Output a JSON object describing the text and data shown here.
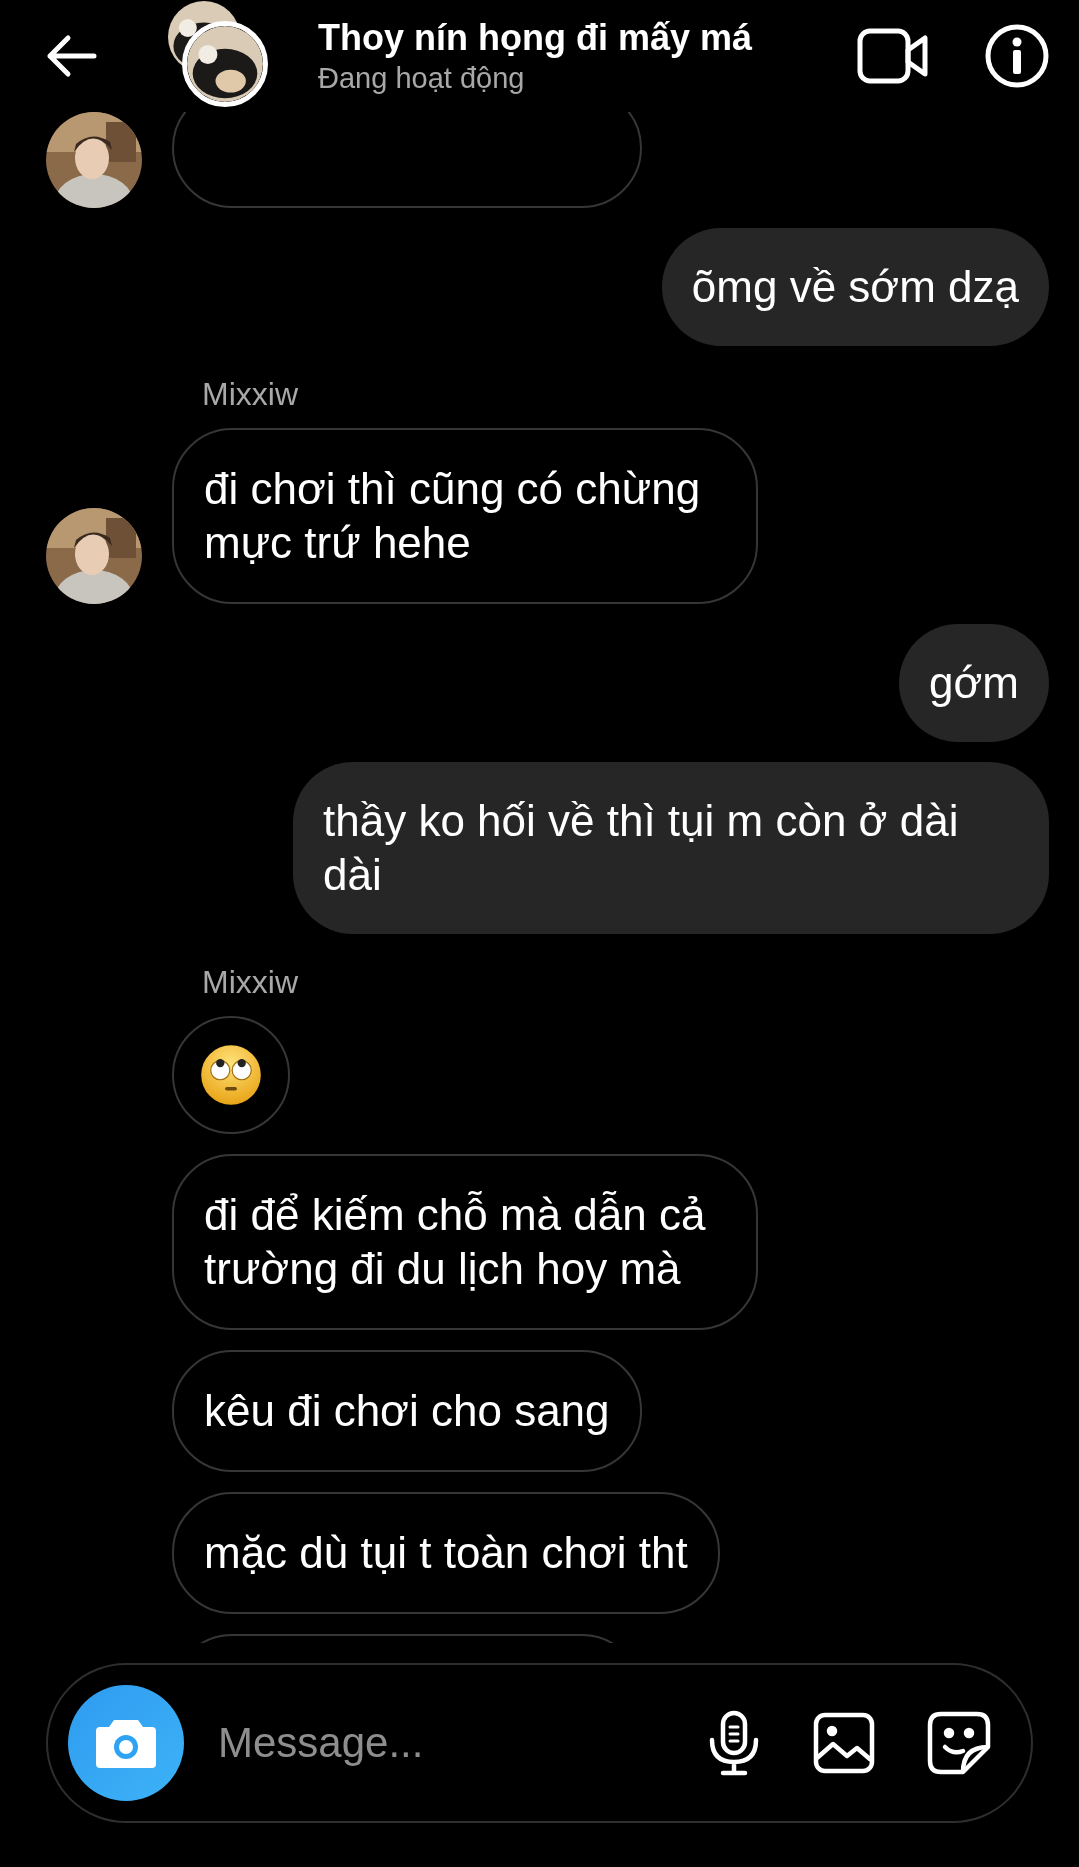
{
  "header": {
    "title": "Thoy nín họng đi mấy má",
    "status": "Đang hoạt động"
  },
  "messages": [
    {
      "kind": "cut",
      "outgoing": false,
      "avatar": true
    },
    {
      "kind": "text",
      "outgoing": true,
      "text": "õmg về sớm dzạ"
    },
    {
      "kind": "sender",
      "text": "Mixxiw"
    },
    {
      "kind": "text",
      "outgoing": false,
      "text": "đi chơi thì cũng có chừng mực trứ hehe",
      "avatar": true
    },
    {
      "kind": "text",
      "outgoing": true,
      "text": "gớm"
    },
    {
      "kind": "text",
      "outgoing": true,
      "text": "thầy ko hối về thì tụi m còn ở dài dài"
    },
    {
      "kind": "sender",
      "text": "Mixxiw"
    },
    {
      "kind": "emoji",
      "outgoing": false
    },
    {
      "kind": "text",
      "outgoing": false,
      "text": "đi để kiếm chỗ mà dẫn cả trường đi du lịch hoy mà"
    },
    {
      "kind": "text",
      "outgoing": false,
      "text": "kêu đi chơi cho sang"
    },
    {
      "kind": "text",
      "outgoing": false,
      "text": "mặc dù tụi t toàn chơi tht"
    },
    {
      "kind": "cut",
      "outgoing": false
    }
  ],
  "composer": {
    "placeholder": "Message..."
  }
}
